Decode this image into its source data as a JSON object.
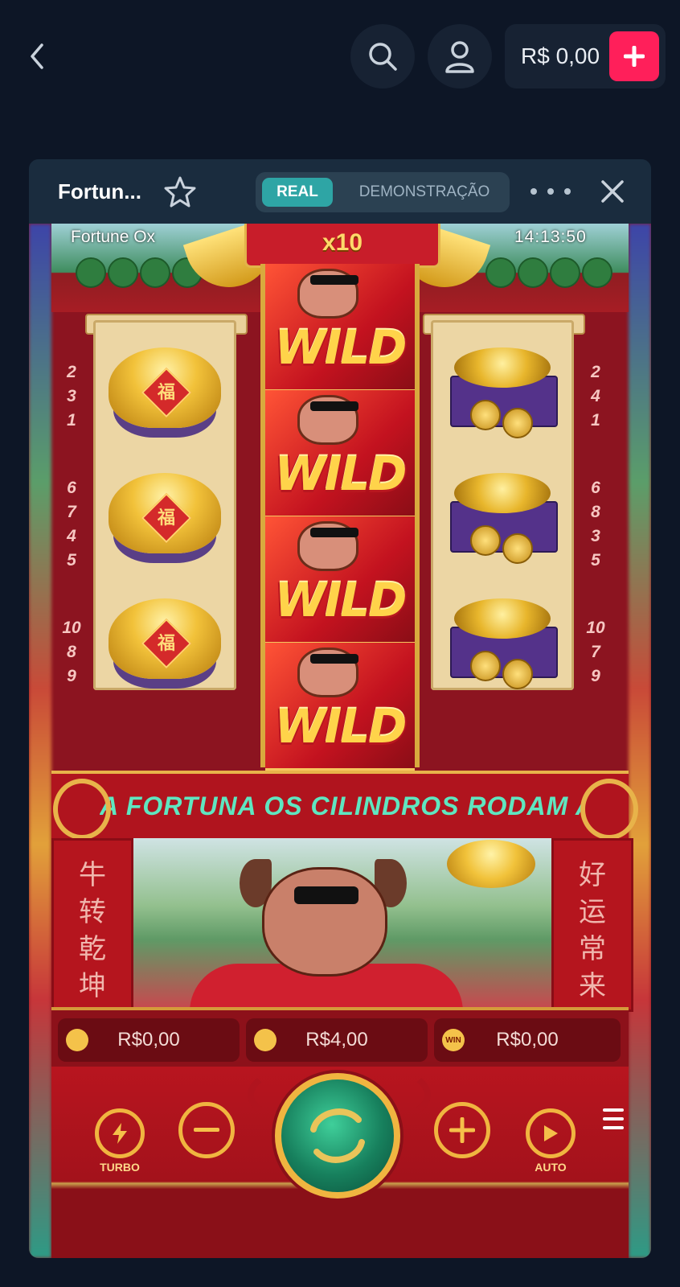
{
  "header": {
    "back_icon": "chevron-left-icon",
    "search_icon": "search-icon",
    "user_icon": "user-icon",
    "balance": "R$ 0,00",
    "deposit_icon": "plus-icon"
  },
  "panel": {
    "title": "Fortun...",
    "favorite_icon": "star-icon",
    "mode_real": "REAL",
    "mode_demo": "DEMONSTRAÇÃO",
    "more_icon": "more-icon",
    "close_icon": "close-icon"
  },
  "game": {
    "name": "Fortune Ox",
    "clock": "14:13:50",
    "multiplier": "x10",
    "paylines_left": [
      "2",
      "3",
      "1",
      "6",
      "7",
      "4",
      "5",
      "10",
      "8",
      "9"
    ],
    "paylines_right": [
      "2",
      "4",
      "1",
      "6",
      "8",
      "3",
      "5",
      "10",
      "7",
      "9"
    ],
    "reel_middle": [
      "WILD",
      "WILD",
      "WILD",
      "WILD"
    ],
    "banner": "A FORTUNA OS CILINDROS RODAM ATÉ",
    "pillar_left": [
      "牛",
      "转",
      "乾",
      "坤"
    ],
    "pillar_right": [
      "好",
      "运",
      "常",
      "来"
    ],
    "fu_char": "福",
    "balance_value": "R$0,00",
    "bet_value": "R$4,00",
    "win_value": "R$0,00",
    "win_label": "WIN",
    "turbo_label": "TURBO",
    "auto_label": "AUTO",
    "colors": {
      "accent": "#ff1f5a",
      "toggle_active": "#2ea5a5",
      "game_red": "#b0141e",
      "gold": "#f0b540"
    }
  }
}
